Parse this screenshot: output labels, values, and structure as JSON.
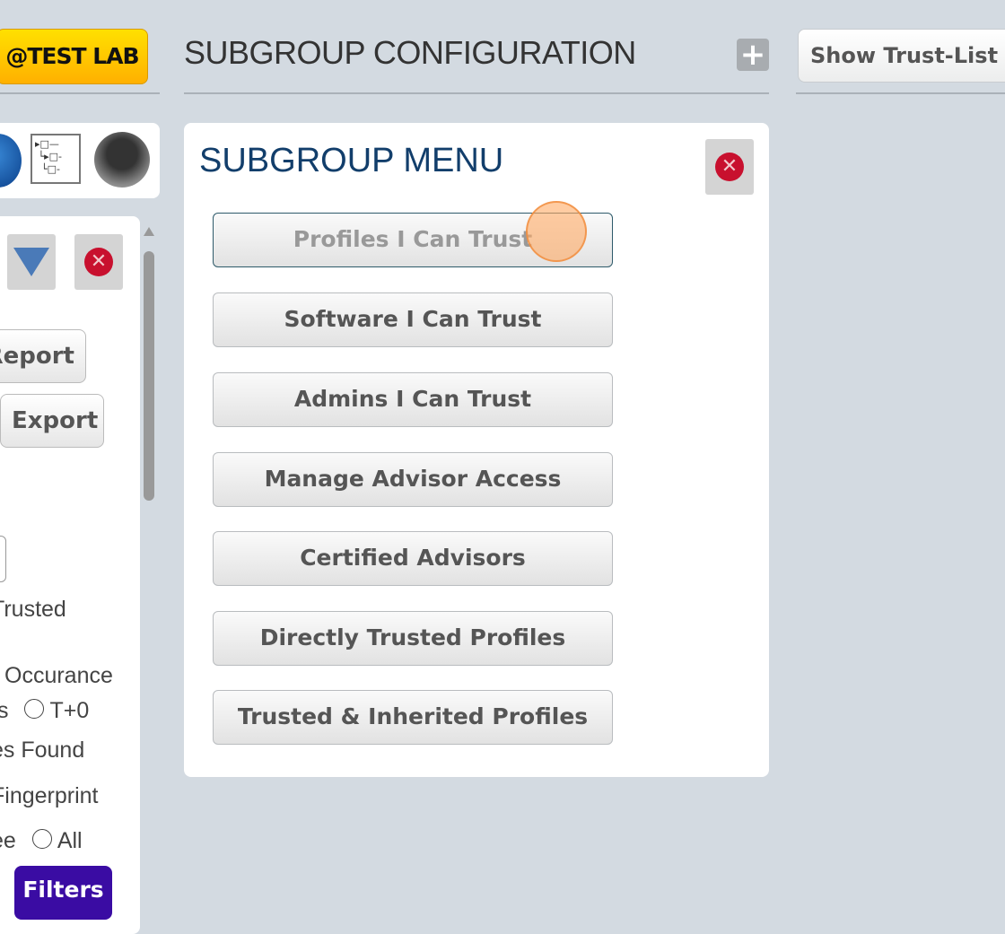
{
  "header": {
    "org_badge": "@TEST LAB",
    "title": "SUBGROUP CONFIGURATION",
    "show_trust_list": "Show Trust-List"
  },
  "left_panel": {
    "report_label": "Report",
    "export_label": "Export",
    "options": [
      "Trusted",
      "Occurance",
      "ts",
      "T+0",
      "es Found",
      "Fingerprint",
      "ee",
      "All"
    ],
    "filters_label": "Filters",
    "filters_color": "#3a0ca3"
  },
  "subgroup_menu": {
    "title": "SUBGROUP MENU",
    "title_color": "#123e6b",
    "items": [
      {
        "label": "Profiles I Can Trust",
        "focused": true
      },
      {
        "label": "Software I Can Trust"
      },
      {
        "label": "Admins I Can Trust"
      },
      {
        "label": "Manage Advisor Access"
      },
      {
        "label": "Certified Advisors"
      },
      {
        "label": "Directly Trusted Profiles"
      },
      {
        "label": "Trusted & Inherited Profiles"
      }
    ]
  },
  "icons": [
    "globe-icon",
    "hierarchy-icon",
    "avatar-icon",
    "filter-arrow-icon",
    "close-icon",
    "plus-icon"
  ]
}
